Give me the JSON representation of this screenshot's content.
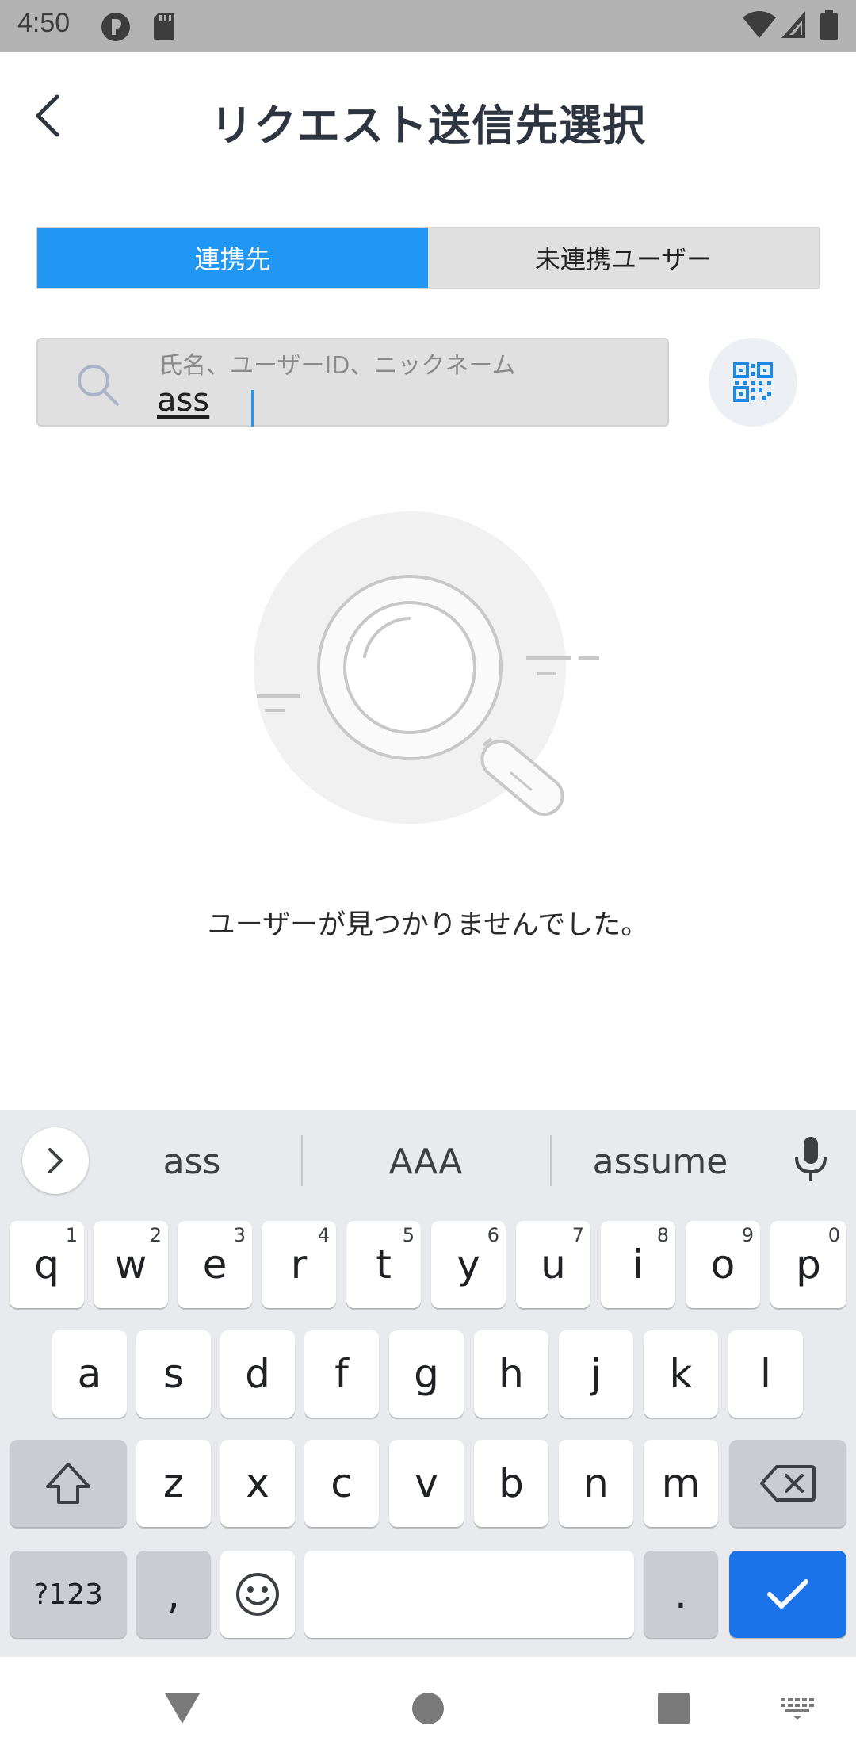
{
  "status_bar": {
    "time": "4:50",
    "left_icons": [
      "p-badge-icon",
      "sd-card-icon"
    ],
    "right_icons": [
      "wifi-icon",
      "cell-signal-icon",
      "battery-icon"
    ]
  },
  "header": {
    "title": "リクエスト送信先選択",
    "back_icon": "chevron-left-icon"
  },
  "tabs": [
    {
      "label": "連携先",
      "active": true
    },
    {
      "label": "未連携ユーザー",
      "active": false
    }
  ],
  "search": {
    "placeholder": "氏名、ユーザーID、ニックネーム",
    "value": "ass",
    "icon": "search-icon",
    "qr_icon": "qr-code-icon"
  },
  "empty_state": {
    "message": "ユーザーが見つかりませんでした。"
  },
  "keyboard": {
    "suggestions": [
      "ass",
      "AAA",
      "assume"
    ],
    "row1": [
      {
        "key": "q",
        "hint": "1"
      },
      {
        "key": "w",
        "hint": "2"
      },
      {
        "key": "e",
        "hint": "3"
      },
      {
        "key": "r",
        "hint": "4"
      },
      {
        "key": "t",
        "hint": "5"
      },
      {
        "key": "y",
        "hint": "6"
      },
      {
        "key": "u",
        "hint": "7"
      },
      {
        "key": "i",
        "hint": "8"
      },
      {
        "key": "o",
        "hint": "9"
      },
      {
        "key": "p",
        "hint": "0"
      }
    ],
    "row2": [
      "a",
      "s",
      "d",
      "f",
      "g",
      "h",
      "j",
      "k",
      "l"
    ],
    "row3": [
      "z",
      "x",
      "c",
      "v",
      "b",
      "n",
      "m"
    ],
    "symbols_label": "?123",
    "comma_label": ",",
    "period_label": "."
  },
  "colors": {
    "accent": "#2196f3",
    "keyboard_action": "#1a73e8",
    "status_bar": "#b3b3b3"
  }
}
